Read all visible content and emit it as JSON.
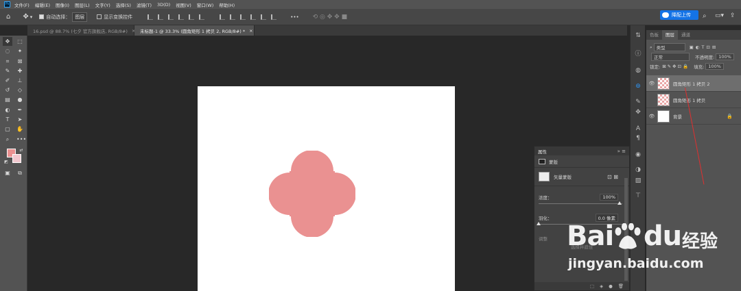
{
  "menubar": {
    "app_icon": "Ps",
    "items": [
      "文件(F)",
      "编辑(E)",
      "图像(I)",
      "图层(L)",
      "文字(Y)",
      "选择(S)",
      "滤镜(T)",
      "3D(D)",
      "视图(V)",
      "窗口(W)",
      "帮助(H)"
    ]
  },
  "options_bar": {
    "auto_select_label": "自动选择：",
    "auto_select_value": "图层",
    "transform_label": "显示变换控件",
    "more": "•••",
    "cloud_button": "降配上传"
  },
  "tabs": [
    {
      "label": "16.psd @ 88.7% (七夕 官方旗舰店, RGB/8#)",
      "close": "×"
    },
    {
      "label": "未标题-1 @ 33.3% (圆角矩形 1 拷贝 2, RGB/8#) *",
      "close": "×"
    }
  ],
  "tools": {
    "more": "•••"
  },
  "layers_panel": {
    "tabs": [
      "色板",
      "图层",
      "通道"
    ],
    "filter_kind": "类型",
    "blend_mode": "正常",
    "opacity_label": "不透明度:",
    "opacity_value": "100%",
    "lock_label": "锁定:",
    "fill_label": "填充:",
    "fill_value": "100%",
    "layers": [
      {
        "name": "圆角矩形 1 拷贝 2",
        "selected": true,
        "visible": true
      },
      {
        "name": "圆角矩形 1 拷贝",
        "selected": false,
        "visible": false
      },
      {
        "name": "背景",
        "selected": false,
        "visible": true,
        "locked": true
      }
    ]
  },
  "properties_panel": {
    "title": "属性",
    "section": "蒙版",
    "mask_type": "矢量蒙版",
    "density_label": "浓度：",
    "density_value": "100%",
    "feather_label": "羽化：",
    "feather_value": "0.0 像素",
    "refine_label": "调整",
    "select_and_mask": "选择并遮住"
  },
  "watermark": {
    "brand": "Bai",
    "brand_du": "du",
    "cn": "经验",
    "url": "jingyan.baidu.com"
  },
  "colors": {
    "shape_fill": "#ea9191",
    "foreground": "#ea9191",
    "background": "#f2c8cf",
    "accent": "#1473e6"
  }
}
